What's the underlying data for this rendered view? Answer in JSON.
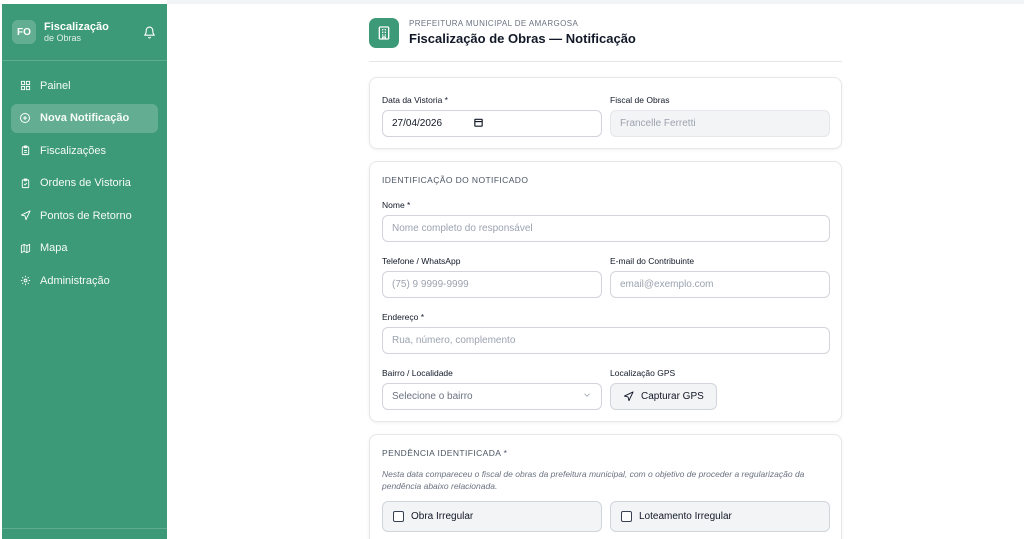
{
  "sidebar": {
    "badge": "FO",
    "title": "Fiscalização",
    "subtitle": "de Obras",
    "items": [
      {
        "label": "Painel",
        "icon": "grid-icon"
      },
      {
        "label": "Nova Notificação",
        "icon": "plus-circle-icon",
        "active": true
      },
      {
        "label": "Fiscalizações",
        "icon": "clipboard-icon"
      },
      {
        "label": "Ordens de Vistoria",
        "icon": "clipboard-check-icon"
      },
      {
        "label": "Pontos de Retorno",
        "icon": "navigation-icon"
      },
      {
        "label": "Mapa",
        "icon": "map-icon"
      },
      {
        "label": "Administração",
        "icon": "gear-icon"
      }
    ]
  },
  "header": {
    "org": "PREFEITURA MUNICIPAL DE AMARGOSA",
    "title": "Fiscalização de Obras — Notificação"
  },
  "vistoria": {
    "date_label": "Data da Vistoria *",
    "date_value": "27/04/2026",
    "fiscal_label": "Fiscal de Obras",
    "fiscal_value": "Francelle Ferretti"
  },
  "notificado": {
    "section_title": "IDENTIFICAÇÃO DO NOTIFICADO",
    "nome_label": "Nome *",
    "nome_placeholder": "Nome completo do responsável",
    "telefone_label": "Telefone / WhatsApp",
    "telefone_placeholder": "(75) 9 9999-9999",
    "email_label": "E-mail do Contribuinte",
    "email_placeholder": "email@exemplo.com",
    "endereco_label": "Endereço *",
    "endereco_placeholder": "Rua, número, complemento",
    "bairro_label": "Bairro / Localidade",
    "bairro_placeholder": "Selecione o bairro",
    "gps_label": "Localização GPS",
    "gps_button": "Capturar GPS"
  },
  "pendencia": {
    "section_title": "PENDÊNCIA IDENTIFICADA *",
    "description": "Nesta data compareceu o fiscal de obras da prefeitura municipal, com o objetivo de proceder a regularização da pendência abaixo relacionada.",
    "options": [
      "Obra Irregular",
      "Loteamento Irregular"
    ]
  },
  "colors": {
    "primary": "#3d9a78"
  }
}
